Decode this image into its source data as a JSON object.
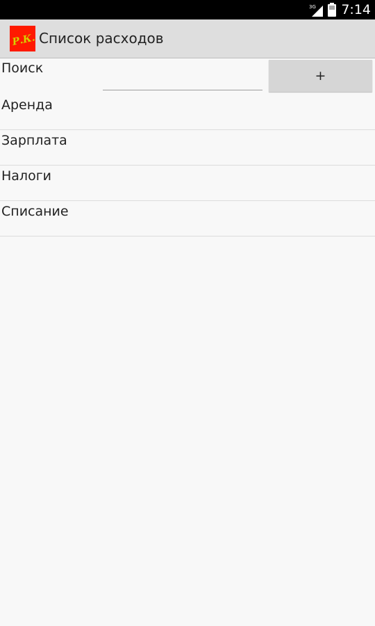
{
  "status_bar": {
    "network": "3G",
    "time": "7:14",
    "icons": [
      "signal-icon",
      "battery-icon"
    ]
  },
  "action_bar": {
    "title": "Список расходов",
    "icon": "app-logo-icon",
    "icon_text": "Р.К.",
    "icon_colors": {
      "background": "#ff1a00",
      "text": "#d4d400"
    }
  },
  "search": {
    "label": "Поиск",
    "value": "",
    "placeholder": ""
  },
  "add_button": {
    "label": "+"
  },
  "expenses": [
    {
      "label": "Аренда"
    },
    {
      "label": "Зарплата"
    },
    {
      "label": "Налоги"
    },
    {
      "label": "Списание"
    }
  ]
}
